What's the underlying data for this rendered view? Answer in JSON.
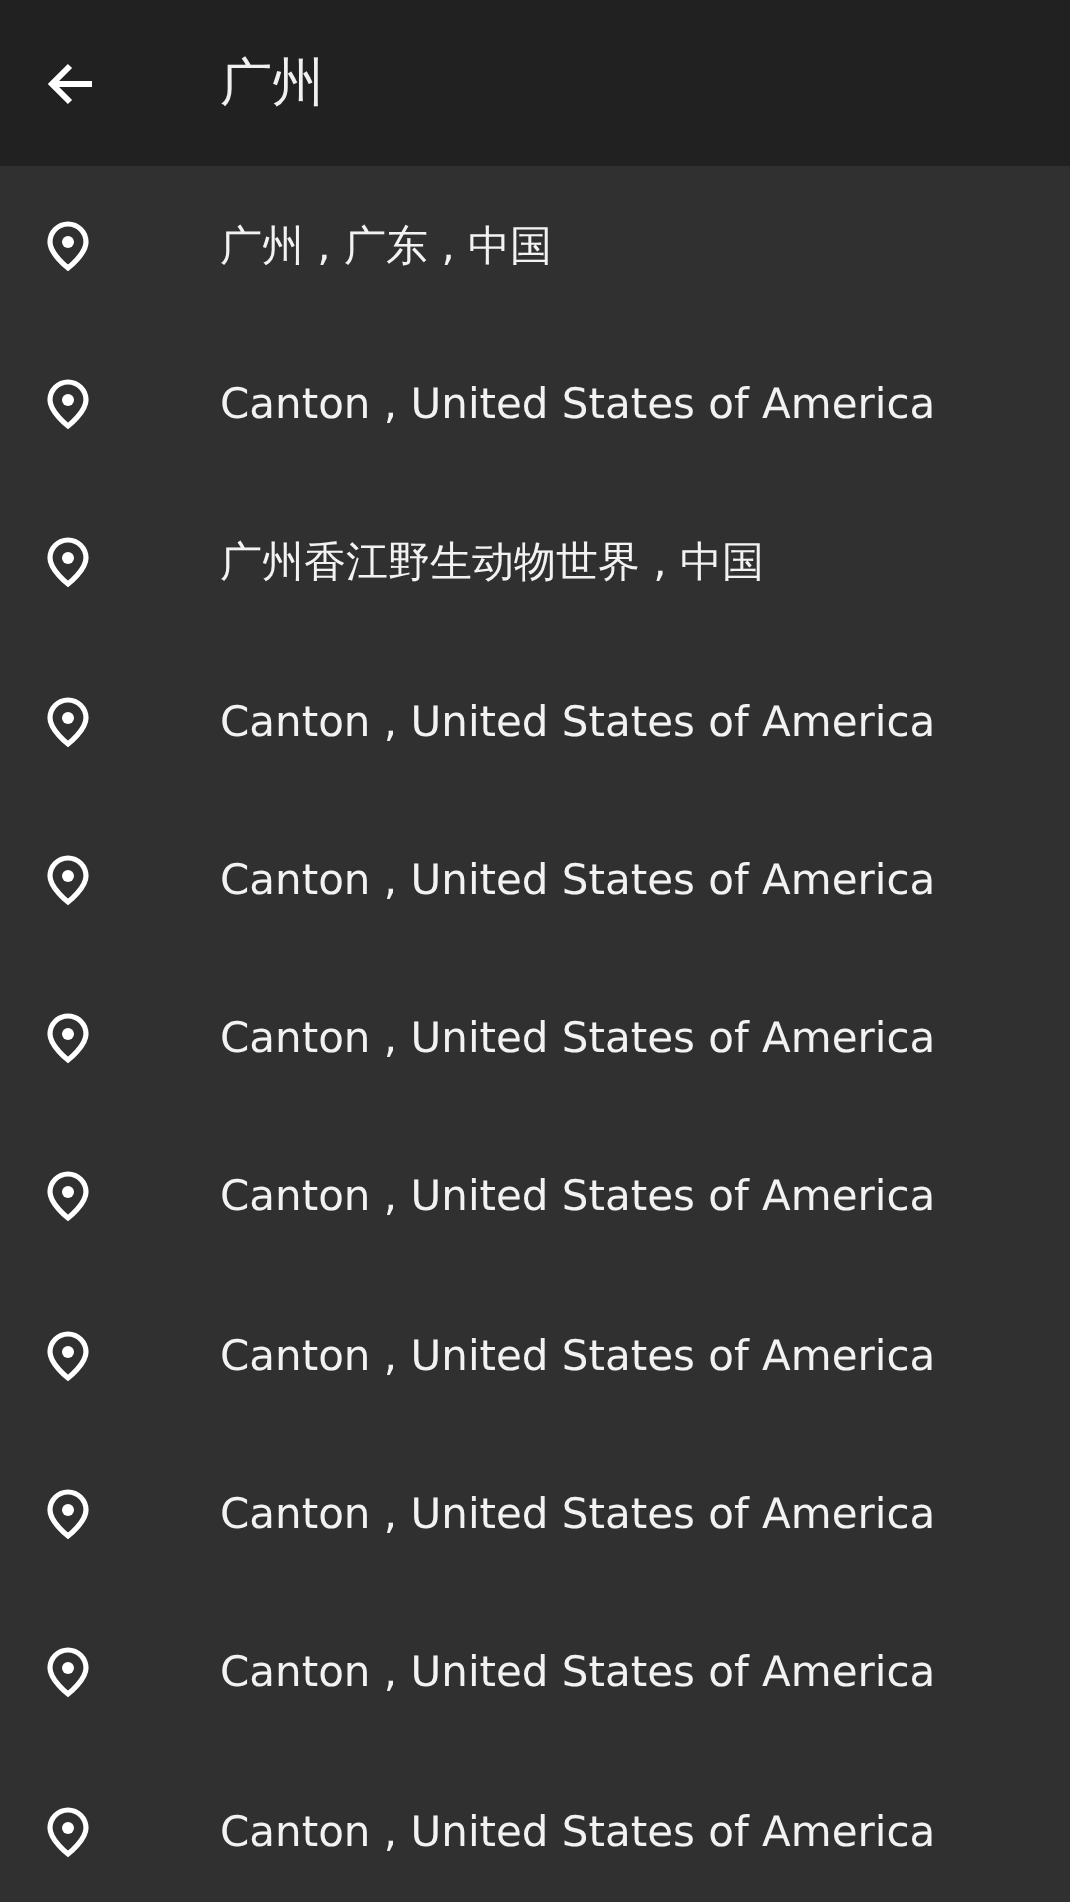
{
  "search": {
    "value": "广州"
  },
  "results": [
    {
      "label": "广州 , 广东 , 中国"
    },
    {
      "label": "Canton , United States of America"
    },
    {
      "label": "广州香江野生动物世界 , 中国"
    },
    {
      "label": "Canton , United States of America"
    },
    {
      "label": "Canton , United States of America"
    },
    {
      "label": "Canton , United States of America"
    },
    {
      "label": "Canton , United States of America"
    },
    {
      "label": "Canton , United States of America"
    },
    {
      "label": "Canton , United States of America"
    },
    {
      "label": "Canton , United States of America"
    },
    {
      "label": "Canton , United States of America"
    }
  ]
}
